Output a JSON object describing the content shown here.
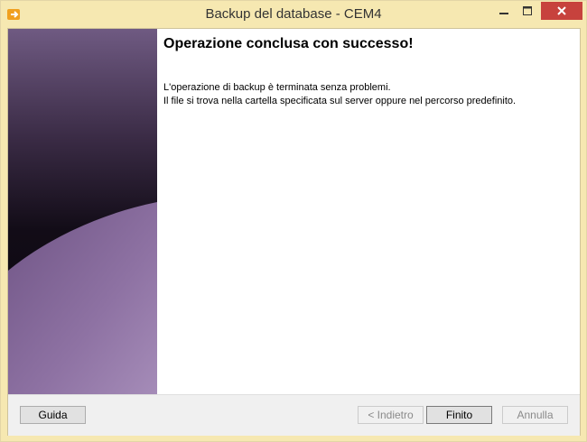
{
  "window": {
    "title": "Backup del database - CEM4"
  },
  "content": {
    "heading": "Operazione conclusa con successo!",
    "line1": "L'operazione di backup è terminata senza problemi.",
    "line2": "Il file si trova nella cartella specificata sul server oppure nel percorso predefinito."
  },
  "buttons": {
    "help": "Guida",
    "back": "< Indietro",
    "finish": "Finito",
    "cancel": "Annulla"
  },
  "colors": {
    "titlebar": "#f6e8b1",
    "close": "#c7423d",
    "sidebar_dark": "#1a1320",
    "sidebar_light": "#8e72a3"
  }
}
